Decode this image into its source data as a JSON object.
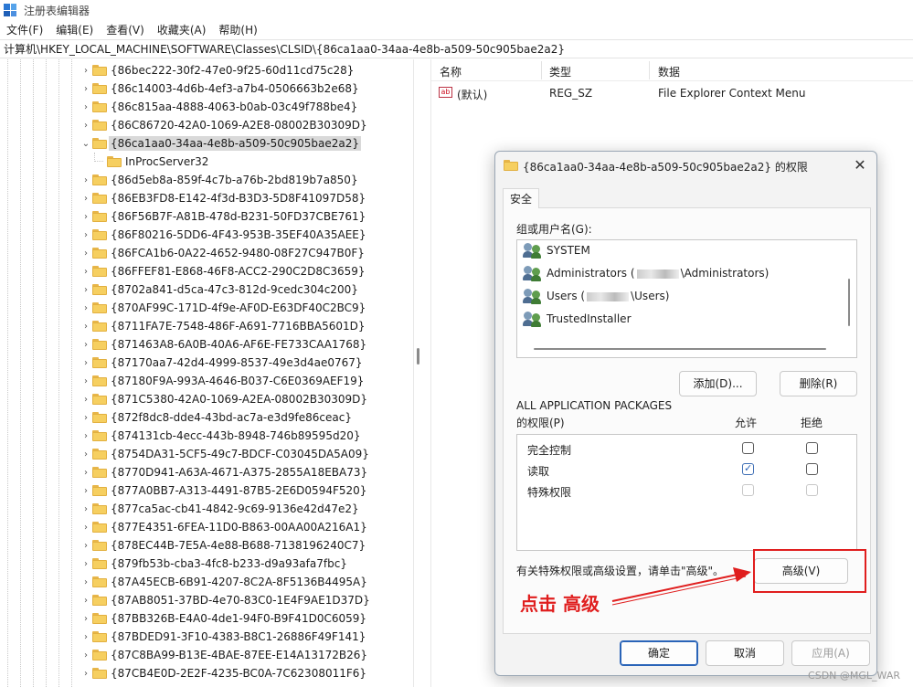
{
  "window": {
    "title": "注册表编辑器"
  },
  "menu": [
    "文件(F)",
    "编辑(E)",
    "查看(V)",
    "收藏夹(A)",
    "帮助(H)"
  ],
  "address": "计算机\\HKEY_LOCAL_MACHINE\\SOFTWARE\\Classes\\CLSID\\{86ca1aa0-34aa-4e8b-a509-50c905bae2a2}",
  "tree": [
    {
      "label": "{86bec222-30f2-47e0-9f25-60d11cd75c28}",
      "level": 0,
      "expander": "›"
    },
    {
      "label": "{86c14003-4d6b-4ef3-a7b4-0506663b2e68}",
      "level": 0,
      "expander": "›"
    },
    {
      "label": "{86c815aa-4888-4063-b0ab-03c49f788be4}",
      "level": 0,
      "expander": "›"
    },
    {
      "label": "{86C86720-42A0-1069-A2E8-08002B30309D}",
      "level": 0,
      "expander": "›"
    },
    {
      "label": "{86ca1aa0-34aa-4e8b-a509-50c905bae2a2}",
      "level": 0,
      "expander": "⌄",
      "selected": true
    },
    {
      "label": "InProcServer32",
      "level": 1,
      "expander": ""
    },
    {
      "label": "{86d5eb8a-859f-4c7b-a76b-2bd819b7a850}",
      "level": 0,
      "expander": "›"
    },
    {
      "label": "{86EB3FD8-E142-4f3d-B3D3-5D8F41097D58}",
      "level": 0,
      "expander": "›"
    },
    {
      "label": "{86F56B7F-A81B-478d-B231-50FD37CBE761}",
      "level": 0,
      "expander": "›"
    },
    {
      "label": "{86F80216-5DD6-4F43-953B-35EF40A35AEE}",
      "level": 0,
      "expander": "›"
    },
    {
      "label": "{86FCA1b6-0A22-4652-9480-08F27C947B0F}",
      "level": 0,
      "expander": "›"
    },
    {
      "label": "{86FFEF81-E868-46F8-ACC2-290C2D8C3659}",
      "level": 0,
      "expander": "›"
    },
    {
      "label": "{8702a841-d5ca-47c3-812d-9cedc304c200}",
      "level": 0,
      "expander": "›"
    },
    {
      "label": "{870AF99C-171D-4f9e-AF0D-E63DF40C2BC9}",
      "level": 0,
      "expander": "›"
    },
    {
      "label": "{8711FA7E-7548-486F-A691-7716BBA5601D}",
      "level": 0,
      "expander": "›"
    },
    {
      "label": "{871463A8-6A0B-40A6-AF6E-FE733CAA1768}",
      "level": 0,
      "expander": "›"
    },
    {
      "label": "{87170aa7-42d4-4999-8537-49e3d4ae0767}",
      "level": 0,
      "expander": "›"
    },
    {
      "label": "{87180F9A-993A-4646-B037-C6E0369AEF19}",
      "level": 0,
      "expander": "›"
    },
    {
      "label": "{871C5380-42A0-1069-A2EA-08002B30309D}",
      "level": 0,
      "expander": "›"
    },
    {
      "label": "{872f8dc8-dde4-43bd-ac7a-e3d9fe86ceac}",
      "level": 0,
      "expander": "›"
    },
    {
      "label": "{874131cb-4ecc-443b-8948-746b89595d20}",
      "level": 0,
      "expander": "›"
    },
    {
      "label": "{8754DA31-5CF5-49c7-BDCF-C03045DA5A09}",
      "level": 0,
      "expander": "›"
    },
    {
      "label": "{8770D941-A63A-4671-A375-2855A18EBA73}",
      "level": 0,
      "expander": "›"
    },
    {
      "label": "{877A0BB7-A313-4491-87B5-2E6D0594F520}",
      "level": 0,
      "expander": "›"
    },
    {
      "label": "{877ca5ac-cb41-4842-9c69-9136e42d47e2}",
      "level": 0,
      "expander": "›"
    },
    {
      "label": "{877E4351-6FEA-11D0-B863-00AA00A216A1}",
      "level": 0,
      "expander": "›"
    },
    {
      "label": "{878EC44B-7E5A-4e88-B688-7138196240C7}",
      "level": 0,
      "expander": "›"
    },
    {
      "label": "{879fb53b-cba3-4fc8-b233-d9a93afa7fbc}",
      "level": 0,
      "expander": "›"
    },
    {
      "label": "{87A45ECB-6B91-4207-8C2A-8F5136B4495A}",
      "level": 0,
      "expander": "›"
    },
    {
      "label": "{87AB8051-37BD-4e70-83C0-1E4F9AE1D37D}",
      "level": 0,
      "expander": "›"
    },
    {
      "label": "{87BB326B-E4A0-4de1-94F0-B9F41D0C6059}",
      "level": 0,
      "expander": "›"
    },
    {
      "label": "{87BDED91-3F10-4383-B8C1-26886F49F141}",
      "level": 0,
      "expander": "›"
    },
    {
      "label": "{87C8BA99-B13E-4BAE-87EE-E14A13172B26}",
      "level": 0,
      "expander": "›"
    },
    {
      "label": "{87CB4E0D-2E2F-4235-BC0A-7C62308011F6}",
      "level": 0,
      "expander": "›"
    }
  ],
  "list": {
    "headers": {
      "name": "名称",
      "type": "类型",
      "data": "数据"
    },
    "rows": [
      {
        "icon": "ab",
        "name": "(默认)",
        "type": "REG_SZ",
        "data": "File Explorer Context Menu"
      }
    ]
  },
  "dialog": {
    "title": "{86ca1aa0-34aa-4e8b-a509-50c905bae2a2} 的权限",
    "close": "✕",
    "tab": "安全",
    "group_label": "组或用户名(G):",
    "users": [
      {
        "pre": "SYSTEM",
        "post": ""
      },
      {
        "pre": "Administrators (",
        "post": "\\Administrators)"
      },
      {
        "pre": "Users (",
        "post": "\\Users)"
      },
      {
        "pre": "TrustedInstaller",
        "post": ""
      }
    ],
    "add_button": "添加(D)...",
    "remove_button": "删除(R)",
    "perm_subject": "ALL APPLICATION PACKAGES",
    "perm_label": "的权限(P)",
    "allow_label": "允许",
    "deny_label": "拒绝",
    "permissions": [
      {
        "name": "完全控制",
        "allow": "unchecked",
        "deny": "unchecked"
      },
      {
        "name": "读取",
        "allow": "checked",
        "deny": "unchecked"
      },
      {
        "name": "特殊权限",
        "allow": "disabled",
        "deny": "disabled"
      }
    ],
    "advanced_hint": "有关特殊权限或高级设置，请单击\"高级\"。",
    "advanced_button": "高级(V)",
    "ok_button": "确定",
    "cancel_button": "取消",
    "apply_button": "应用(A)"
  },
  "annotation": {
    "text": "点击 高级",
    "color": "#e01e1e"
  },
  "watermark": "CSDN @MGL_WAR"
}
